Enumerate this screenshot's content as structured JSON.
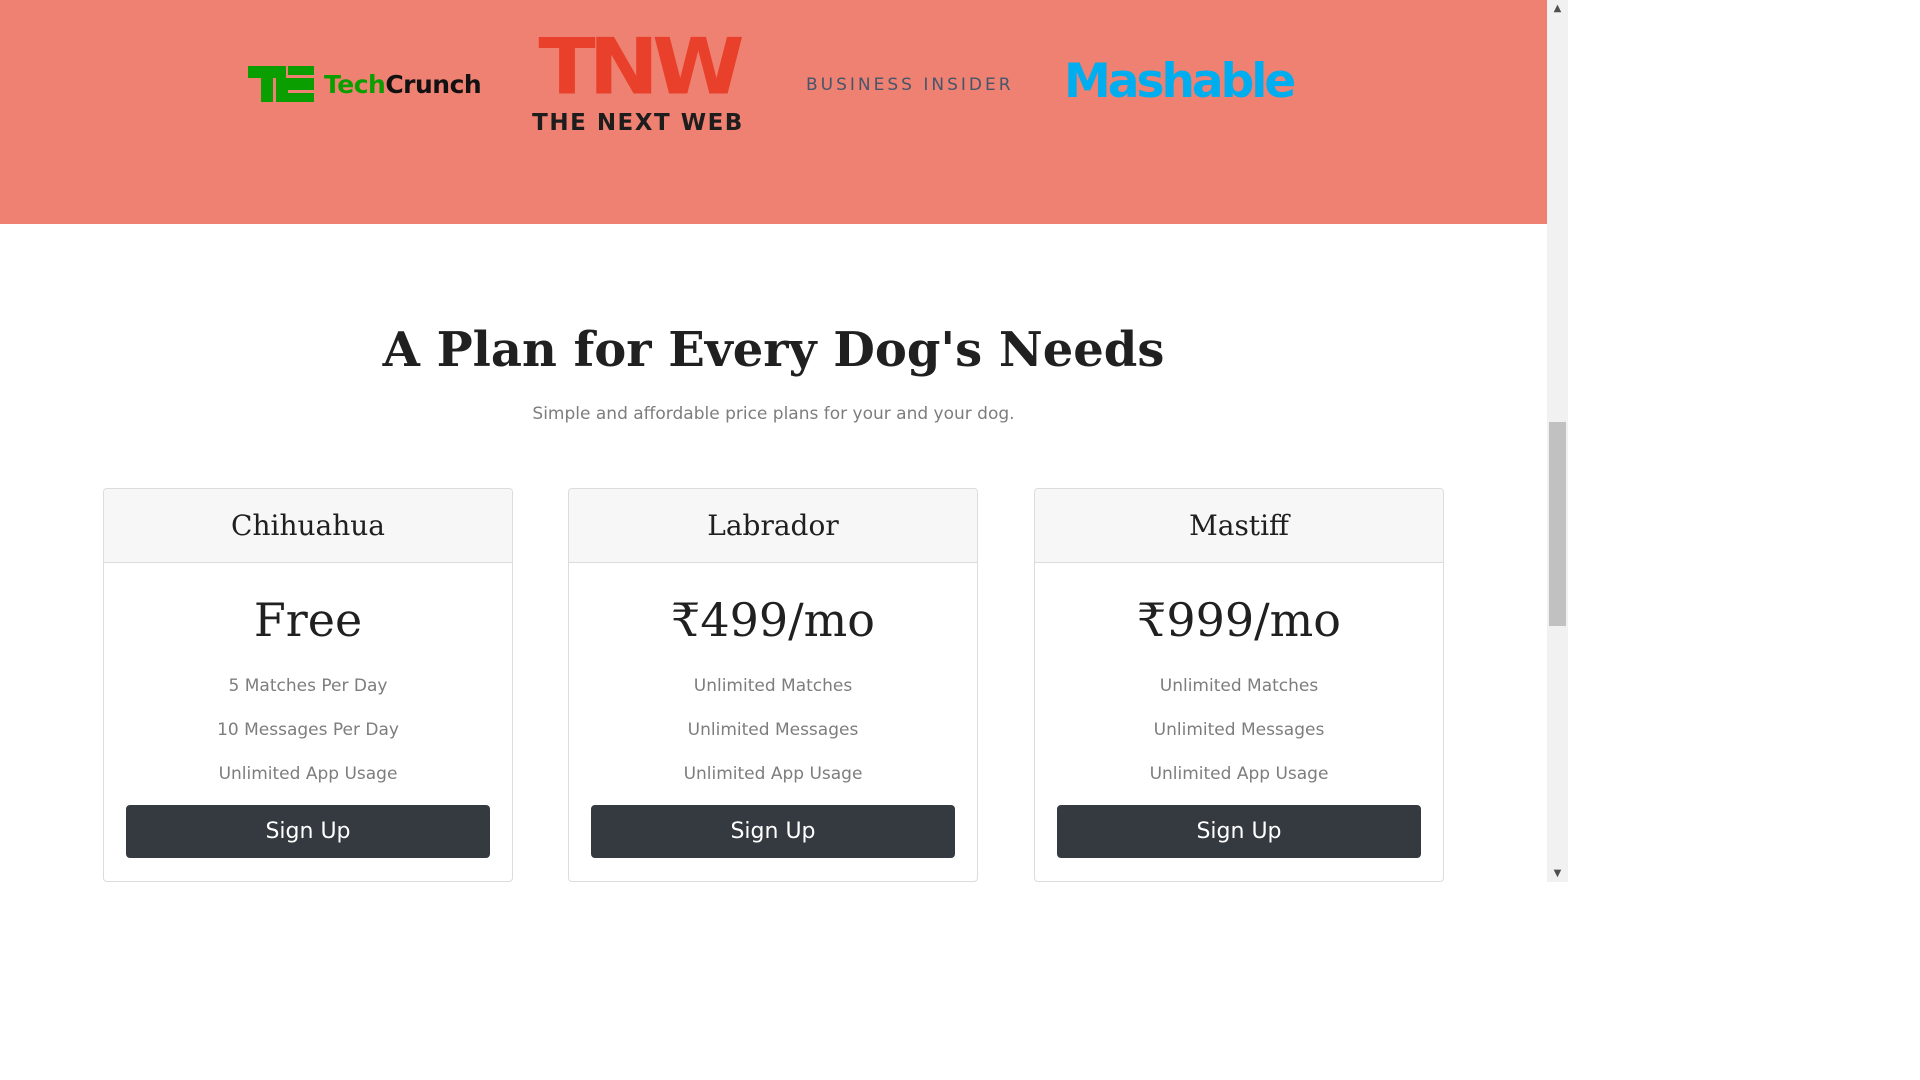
{
  "press": {
    "techcrunch": {
      "tech": "Tech",
      "crunch": "Crunch"
    },
    "tnw": {
      "mark": "TNW",
      "name": "THE NEXT WEB"
    },
    "business_insider": "BUSINESS INSIDER",
    "mashable": "Mashable"
  },
  "pricing": {
    "title": "A Plan for Every Dog's Needs",
    "subtitle": "Simple and affordable price plans for your and your dog.",
    "plans": [
      {
        "name": "Chihuahua",
        "price": "Free",
        "features": [
          "5 Matches Per Day",
          "10 Messages Per Day",
          "Unlimited App Usage"
        ],
        "button": "Sign Up"
      },
      {
        "name": "Labrador",
        "price": "₹499/mo",
        "features": [
          "Unlimited Matches",
          "Unlimited Messages",
          "Unlimited App Usage"
        ],
        "button": "Sign Up"
      },
      {
        "name": "Mastiff",
        "price": "₹999/mo",
        "features": [
          "Unlimited Matches",
          "Unlimited Messages",
          "Unlimited App Usage"
        ],
        "button": "Sign Up"
      }
    ]
  },
  "colors": {
    "press_bg": "#ef8172",
    "button_bg": "#343a40",
    "techcrunch_green": "#0a9e01",
    "tnw_red": "#e8402a",
    "mashable_blue": "#00aeef"
  },
  "scrollbar": {
    "up_icon": "▲",
    "down_icon": "▼"
  }
}
